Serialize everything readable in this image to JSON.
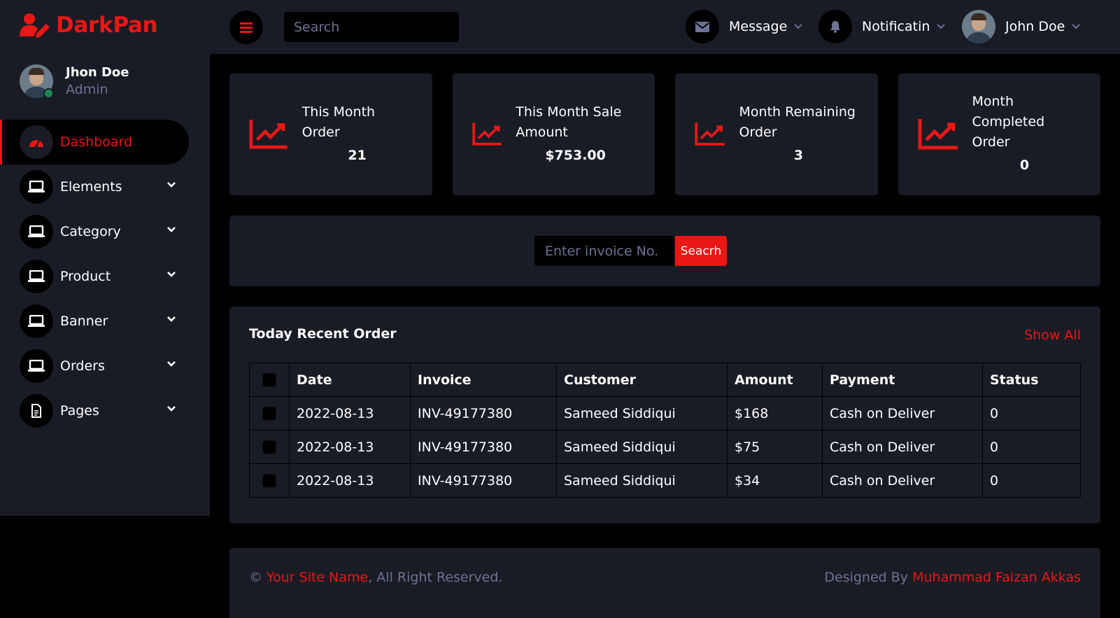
{
  "brand": {
    "name": "DarkPan",
    "logo_icon": "user-edit-icon"
  },
  "colors": {
    "accent": "#eb1616",
    "panel": "#191c24",
    "muted": "#6c7293",
    "background": "#000000",
    "online": "#198754"
  },
  "sidebar": {
    "profile": {
      "name": "Jhon Doe",
      "role": "Admin"
    },
    "items": [
      {
        "label": "Dashboard",
        "icon": "dashboard-gauge-icon",
        "active": true,
        "has_submenu": false
      },
      {
        "label": "Elements",
        "icon": "laptop-icon",
        "active": false,
        "has_submenu": true
      },
      {
        "label": "Category",
        "icon": "laptop-icon",
        "active": false,
        "has_submenu": true
      },
      {
        "label": "Product",
        "icon": "laptop-icon",
        "active": false,
        "has_submenu": true
      },
      {
        "label": "Banner",
        "icon": "laptop-icon",
        "active": false,
        "has_submenu": true
      },
      {
        "label": "Orders",
        "icon": "laptop-icon",
        "active": false,
        "has_submenu": true
      },
      {
        "label": "Pages",
        "icon": "file-icon",
        "active": false,
        "has_submenu": true
      }
    ]
  },
  "topbar": {
    "search_placeholder": "Search",
    "message_label": "Message",
    "notification_label": "Notificatin",
    "user_name": "John Doe"
  },
  "stats": [
    {
      "label": "This Month Order",
      "value": "21"
    },
    {
      "label": "This Month Sale Amount",
      "value": "$753.00"
    },
    {
      "label": "Month Remaining Order",
      "value": "3"
    },
    {
      "label": "Month Completed Order",
      "value": "0"
    }
  ],
  "invoice_search": {
    "placeholder": "Enter invoice No.",
    "button_label": "Seacrh"
  },
  "recent_orders": {
    "title": "Today Recent Order",
    "show_all_label": "Show All",
    "columns": [
      "Date",
      "Invoice",
      "Customer",
      "Amount",
      "Payment",
      "Status"
    ],
    "rows": [
      [
        "2022-08-13",
        "INV-49177380",
        "Sameed Siddiqui",
        "$168",
        "Cash on Deliver",
        "0"
      ],
      [
        "2022-08-13",
        "INV-49177380",
        "Sameed Siddiqui",
        "$75",
        "Cash on Deliver",
        "0"
      ],
      [
        "2022-08-13",
        "INV-49177380",
        "Sameed Siddiqui",
        "$34",
        "Cash on Deliver",
        "0"
      ]
    ]
  },
  "footer": {
    "copyright_symbol": "©",
    "site_name": "Your Site Name",
    "rights_text": ", All Right Reserved.",
    "designed_by": "Designed By ",
    "designer": "Muhammad Faizan Akkas"
  }
}
